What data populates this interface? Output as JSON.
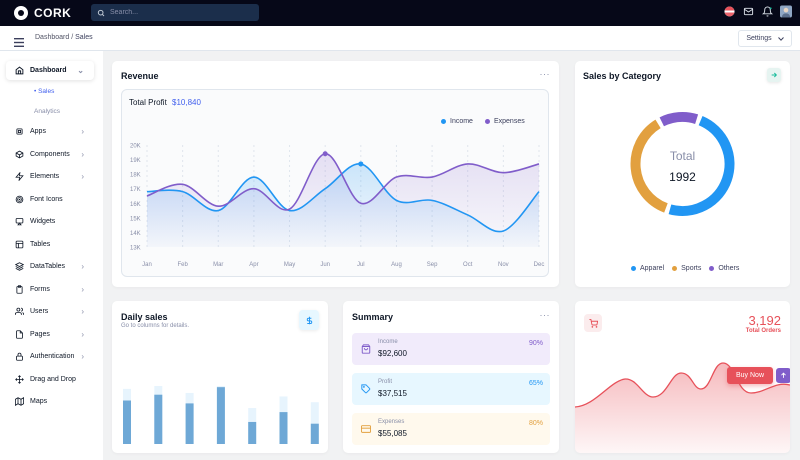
{
  "brand": {
    "name": "CORK"
  },
  "topbar": {
    "search_placeholder": "Search..."
  },
  "breadcrumb": {
    "parent": "Dashboard",
    "separator": "/",
    "current": "Sales"
  },
  "settings_label": "Settings",
  "sidebar": {
    "dashboard": "Dashboard",
    "sub_items": [
      "Sales",
      "Analytics"
    ],
    "items": [
      {
        "label": "Apps",
        "icon": "cpu-icon",
        "chevron": true
      },
      {
        "label": "Components",
        "icon": "box-icon",
        "chevron": true
      },
      {
        "label": "Elements",
        "icon": "zap-icon",
        "chevron": true
      },
      {
        "label": "Font Icons",
        "icon": "target-icon",
        "chevron": false
      },
      {
        "label": "Widgets",
        "icon": "airplay-icon",
        "chevron": false
      },
      {
        "label": "Tables",
        "icon": "layout-icon",
        "chevron": false
      },
      {
        "label": "DataTables",
        "icon": "layers-icon",
        "chevron": true
      },
      {
        "label": "Forms",
        "icon": "clipboard-icon",
        "chevron": true
      },
      {
        "label": "Users",
        "icon": "users-icon",
        "chevron": true
      },
      {
        "label": "Pages",
        "icon": "file-icon",
        "chevron": true
      },
      {
        "label": "Authentication",
        "icon": "lock-icon",
        "chevron": true
      },
      {
        "label": "Drag and Drop",
        "icon": "move-icon",
        "chevron": false
      },
      {
        "label": "Maps",
        "icon": "map-icon",
        "chevron": false
      }
    ]
  },
  "revenue": {
    "title": "Revenue",
    "total_label": "Total Profit",
    "total_value": "$10,840",
    "legend": {
      "income": "Income",
      "expenses": "Expenses"
    }
  },
  "sales_category": {
    "title": "Sales by Category",
    "center_label": "Total",
    "center_value": "1992",
    "legend": [
      "Apparel",
      "Sports",
      "Others"
    ]
  },
  "daily_sales": {
    "title": "Daily sales",
    "subtitle": "Go to columns for details.",
    "bars": [
      {
        "value": 0.75,
        "total": 0.95
      },
      {
        "value": 0.85,
        "total": 1.0
      },
      {
        "value": 0.7,
        "total": 0.88
      },
      {
        "value": 0.98,
        "total": 1.0
      },
      {
        "value": 0.38,
        "total": 0.62
      },
      {
        "value": 0.55,
        "total": 0.82
      },
      {
        "value": 0.35,
        "total": 0.72
      }
    ]
  },
  "summary": {
    "title": "Summary",
    "rows": [
      {
        "label": "Income",
        "value": "$92,600",
        "pct": "90%",
        "bg": "#f1ebfb",
        "color": "#805dca",
        "icon": "shopping-bag-icon"
      },
      {
        "label": "Profit",
        "value": "$37,515",
        "pct": "65%",
        "bg": "#e7f7ff",
        "color": "#2196f3",
        "icon": "tag-icon"
      },
      {
        "label": "Expenses",
        "value": "$55,085",
        "pct": "80%",
        "bg": "#fff9ed",
        "color": "#e2a03f",
        "icon": "credit-card-icon"
      }
    ]
  },
  "orders": {
    "value": "3,192",
    "label": "Total Orders",
    "button": "Buy Now"
  },
  "colors": {
    "income": "#2196f3",
    "expenses": "#805dca",
    "sports": "#e2a03f",
    "danger": "#e7515a"
  },
  "chart_data": [
    {
      "type": "line",
      "title": "Revenue",
      "categories": [
        "Jan",
        "Feb",
        "Mar",
        "Apr",
        "May",
        "Jun",
        "Jul",
        "Aug",
        "Sep",
        "Oct",
        "Nov",
        "Dec"
      ],
      "ylim": [
        13000,
        20000
      ],
      "y_ticks": [
        "13K",
        "14K",
        "15K",
        "16K",
        "17K",
        "18K",
        "19K",
        "20K"
      ],
      "series": [
        {
          "name": "Income",
          "values": [
            16800,
            16800,
            15500,
            17800,
            15500,
            17000,
            18700,
            16200,
            16200,
            15200,
            14100,
            16800
          ]
        },
        {
          "name": "Expenses",
          "values": [
            16500,
            17300,
            15800,
            17000,
            15600,
            19400,
            16000,
            17800,
            17800,
            18700,
            18100,
            18700
          ]
        }
      ]
    },
    {
      "type": "pie",
      "title": "Sales by Category",
      "categories": [
        "Apparel",
        "Sports",
        "Others"
      ],
      "values": [
        985,
        737,
        270
      ]
    },
    {
      "type": "bar",
      "title": "Daily sales",
      "values": [
        0.75,
        0.85,
        0.7,
        0.98,
        0.38,
        0.55,
        0.35
      ]
    }
  ]
}
